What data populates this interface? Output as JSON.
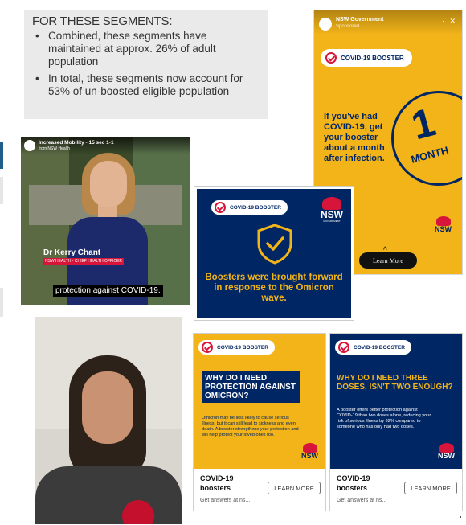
{
  "segments": {
    "title": "FOR THESE SEGMENTS:",
    "bullets": [
      "Combined, these segments have maintained at approx. 26% of adult population",
      "In total, these segments now account for 53% of un-boosted eligible population"
    ]
  },
  "story_ad": {
    "account": "NSW Government",
    "sponsored": "Sponsored",
    "controls": "··· ✕",
    "pill": "COVID-19 BOOSTER",
    "text": "If you've had COVID-19, get your booster about a month after infection.",
    "big_number": "1",
    "big_unit": "MONTH",
    "logo_text": "NSW",
    "caret": "^",
    "cta": "Learn More",
    "colors": {
      "background": "#f3b419",
      "navy": "#002664",
      "red": "#d7153a"
    }
  },
  "video": {
    "title": "Increased Mobility - 15 sec 1-1",
    "byline": "from NSW Health",
    "speaker_name": "Dr Kerry Chant",
    "speaker_role": "NSW HEALTH - CHIEF HEALTH OFFICER",
    "caption": "protection against COVID-19."
  },
  "omicron_ad": {
    "pill": "COVID-19 BOOSTER",
    "logo_text": "NSW",
    "logo_sub": "GOVERNMENT",
    "icon": "shield-check-icon",
    "headline": "Boosters were brought forward in response to the Omicron wave."
  },
  "carousel": [
    {
      "pill": "COVID-19 BOOSTER",
      "headline": "WHY DO I NEED PROTECTION AGAINST OMICRON?",
      "body": "Omicron may be less likely to cause serious illness, but it can still lead to sickness and even death. A booster strengthens your protection and will help protect your loved ones too.",
      "logo_text": "NSW",
      "title": "COVID-19 boosters",
      "description": "Get answers at ns...",
      "cta": "LEARN MORE"
    },
    {
      "pill": "COVID-19 BOOSTER",
      "headline": "WHY DO I NEED THREE DOSES, ISN'T TWO ENOUGH?",
      "body": "A booster offers better protection against COVID-19 than two doses alone, reducing your risk of serious illness by 92% compared to someone who has only had two doses.",
      "logo_text": "NSW",
      "title": "COVID-19 boosters",
      "description": "Get answers at ns...",
      "cta": "LEARN MORE"
    }
  ]
}
